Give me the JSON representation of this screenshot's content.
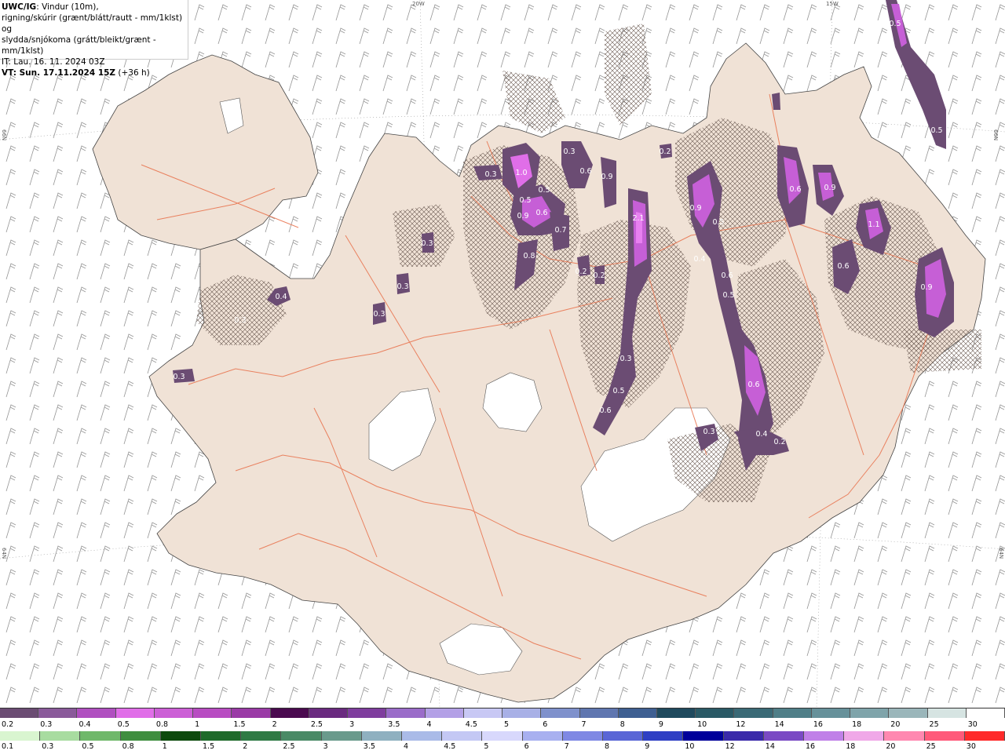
{
  "header": {
    "product": "UWC/IG",
    "line1_rest": ": Vindur (10m),",
    "line2": "rigning/skúrir (grænt/blátt/rautt - mm/1klst) og",
    "line3": "slydda/snjókoma (grátt/bleikt/grænt - mm/1klst)",
    "line4_prefix": "IT: ",
    "line4": "Lau. 16. 11. 2024 03Z",
    "line5_prefix": "VT: ",
    "line5": "Sun. 17.11.2024 15Z",
    "line5_suffix": " (+36 h)"
  },
  "graticule": {
    "top_20w": "20W",
    "top_15w": "15W",
    "left_66n": "66N",
    "right_66n": "66N",
    "left_64n": "64N",
    "right_64n": "64N"
  },
  "precip_labels": [
    "0.5",
    "0.5",
    "0.2",
    "1.0",
    "0.3",
    "0.5",
    "0.6",
    "0.9",
    "0.5",
    "0.6",
    "0.9",
    "0.7",
    "0.3",
    "0.8",
    "0.2",
    "0.2",
    "2.1",
    "0.9",
    "0.5",
    "0.4",
    "0.6",
    "0.5",
    "0.6",
    "0.9",
    "1.1",
    "0.6",
    "0.9",
    "0.3",
    "0.3",
    "0.3",
    "0.4",
    "0.3",
    "0.3",
    "0.3",
    "0.5",
    "0.6",
    "0.3",
    "0.6",
    "0.4",
    "0.2"
  ],
  "snow_scale": {
    "labels": [
      "0.2",
      "0.3",
      "0.4",
      "0.5",
      "0.8",
      "1",
      "1.5",
      "2",
      "2.5",
      "3",
      "3.5",
      "4",
      "4.5",
      "5",
      "6",
      "7",
      "8",
      "9",
      "10",
      "12",
      "14",
      "16",
      "18",
      "20",
      "25",
      "30"
    ],
    "colors": [
      "#6b4c73",
      "#8a5a9a",
      "#b04fc0",
      "#e06ee8",
      "#cc5fd6",
      "#b84cc2",
      "#9a3aa6",
      "#4a0a4f",
      "#6a2a80",
      "#7f3d9e",
      "#9a6cc9",
      "#b3a0e6",
      "#c8c8f4",
      "#a8b0e6",
      "#7f91cc",
      "#5f76b0",
      "#3e5f92",
      "#1f4a5e",
      "#2a5a66",
      "#3a6a76",
      "#4f7f88",
      "#66919a",
      "#7fa4aa",
      "#9ab6ba",
      "#d6e4e2",
      "#ffffff"
    ]
  },
  "rain_scale": {
    "labels": [
      "0.1",
      "0.3",
      "0.5",
      "0.8",
      "1",
      "1.5",
      "2",
      "2.5",
      "3",
      "3.5",
      "4",
      "4.5",
      "5",
      "6",
      "7",
      "8",
      "9",
      "10",
      "12",
      "14",
      "16",
      "18",
      "20",
      "25",
      "30"
    ],
    "colors": [
      "#d9f5d0",
      "#a8dca0",
      "#6fb86a",
      "#3f8e3f",
      "#0d4a0d",
      "#1e6a2a",
      "#2f7a44",
      "#4a8a66",
      "#6a9a8c",
      "#8fb0c0",
      "#aabbe8",
      "#c4c8f4",
      "#d8d8fc",
      "#a8b0f0",
      "#7f88e4",
      "#5a66d6",
      "#2f3fc4",
      "#00009a",
      "#3a2aaa",
      "#7a4ac4",
      "#c080e8",
      "#f0a8e8",
      "#ff88b0",
      "#ff5a7a",
      "#ff2a2a"
    ]
  }
}
